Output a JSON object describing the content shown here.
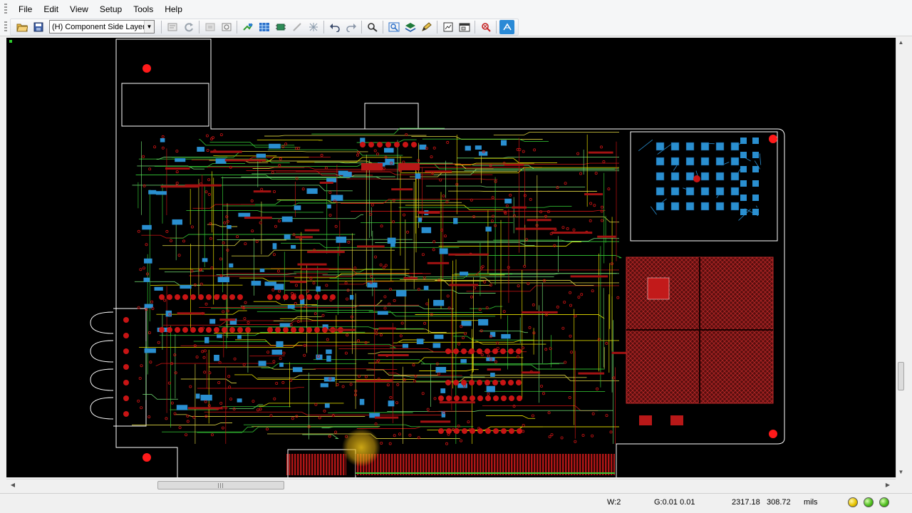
{
  "menu": {
    "file": "File",
    "edit": "Edit",
    "view": "View",
    "setup": "Setup",
    "tools": "Tools",
    "help": "Help"
  },
  "toolbar": {
    "layer_select_value": "(H) Component Side Layer"
  },
  "status": {
    "width": "W:2",
    "grid": "G:0.01 0.01",
    "coord_x": "2317.18",
    "coord_y": "308.72",
    "units": "mils"
  },
  "colors": {
    "board_outline": "#ffffff",
    "trace_red": "#c81414",
    "trace_yellow": "#e8e000",
    "trace_green": "#34c834",
    "pad_blue": "#2a8fd0",
    "copper_fill": "#8a1a1a",
    "canvas_bg": "#000000",
    "cursor_highlight": "#f0c419"
  },
  "icons": [
    "open-folder-icon",
    "save-icon",
    "properties-icon",
    "redraw-icon",
    "disabled-icon",
    "hatch-icon",
    "route-icon",
    "grid-icon",
    "component-icon",
    "line-icon",
    "cross-icon",
    "undo-icon",
    "redo-icon",
    "zoom-icon",
    "zoom-box-icon",
    "layer-view-icon",
    "pencil-icon",
    "report-icon",
    "window-icon",
    "drc-icon",
    "help-icon"
  ]
}
